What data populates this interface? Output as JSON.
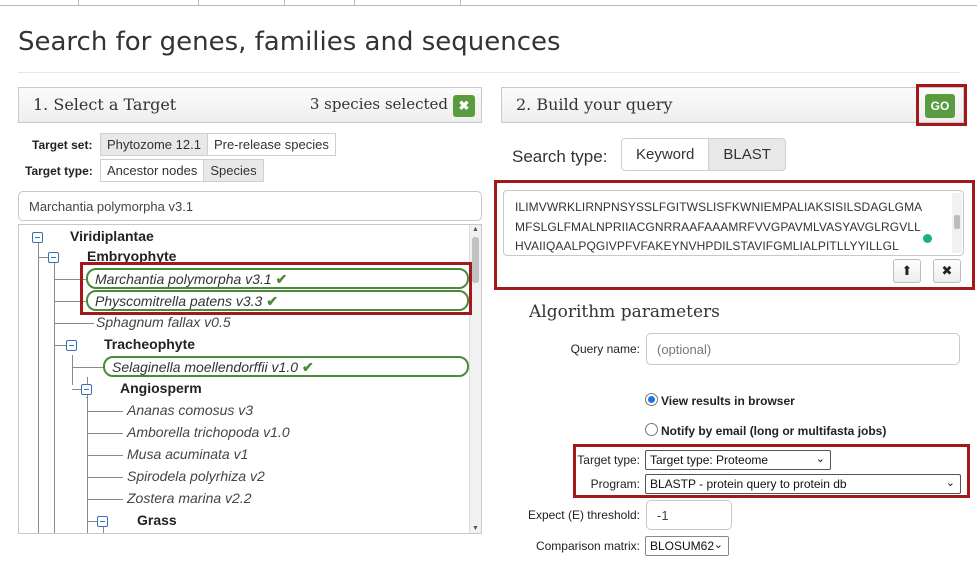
{
  "page": {
    "title": "Search for genes, families and sequences"
  },
  "target_panel": {
    "title": "1. Select a Target",
    "selected_count": "3 species selected",
    "target_set_label": "Target set:",
    "target_set_options": [
      "Phytozome 12.1",
      "Pre-release species"
    ],
    "target_type_label": "Target type:",
    "target_type_options": [
      "Ancestor nodes",
      "Species"
    ],
    "species_filter_value": "Marchantia polymorpha v3.1",
    "tree": {
      "viridiplantae": "Viridiplantae",
      "embryophyte": "Embryophyte",
      "marchantia": "Marchantia polymorpha v3.1",
      "physcomitrella": "Physcomitrella patens v3.3",
      "sphagnum": "Sphagnum fallax v0.5",
      "tracheophyte": "Tracheophyte",
      "selaginella": "Selaginella moellendorffii v1.0",
      "angiosperm": "Angiosperm",
      "ananas": "Ananas comosus v3",
      "amborella": "Amborella trichopoda v1.0",
      "musa": "Musa acuminata v1",
      "spirodela": "Spirodela polyrhiza v2",
      "zostera": "Zostera marina v2.2",
      "grass": "Grass",
      "checkmark": "✔"
    }
  },
  "query_panel": {
    "title": "2. Build your query",
    "go_label": "GO",
    "search_type_label": "Search type:",
    "search_type_options": [
      "Keyword",
      "BLAST"
    ],
    "search_type_selected": "BLAST",
    "sequence_lines": [
      "ILIMVWRKLIRNPNSYSSLFGITWSLISFKWNIEMPALIAKSISILSDAGLGMA",
      "MFSLGLFMALNPRIIACGNRRAAFAAAMRFVVGPAVMLVASYAVGLRGVLL",
      "HVAIIQAALPQGIVPFVFAKEYNVHPDILSTAVIFGMLIALPITLLYYILLGL"
    ],
    "upload_icon": "⬆",
    "clear_icon": "✖"
  },
  "algorithm": {
    "title": "Algorithm parameters",
    "query_name_label": "Query name:",
    "query_name_placeholder": "(optional)",
    "view_results_label": "View results in browser",
    "notify_email_label": "Notify by email (long or multifasta jobs)",
    "target_type_label": "Target type:",
    "target_type_value": "Target type: Proteome",
    "program_label": "Program:",
    "program_value": "BLASTP - protein query to protein db",
    "expect_label": "Expect (E) threshold:",
    "expect_value": "-1",
    "matrix_label": "Comparison matrix:",
    "matrix_value": "BLOSUM62"
  },
  "colors": {
    "accent_green": "#5b9b3f",
    "highlight_red": "#a31818"
  }
}
